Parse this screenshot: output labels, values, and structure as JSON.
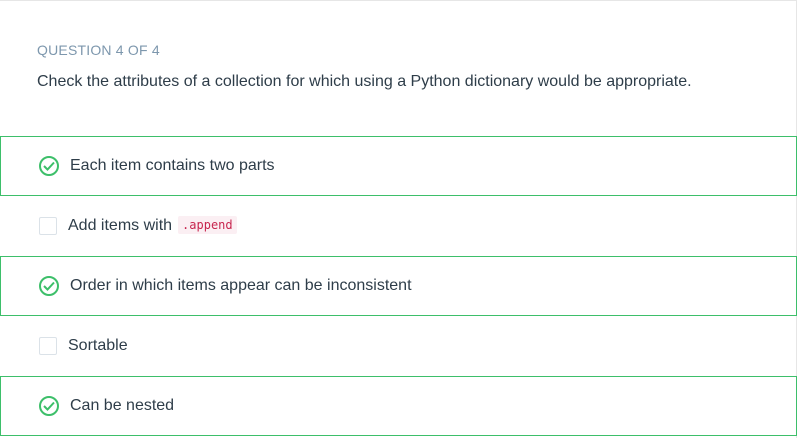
{
  "question": {
    "header": "QUESTION 4 OF 4",
    "text": "Check the attributes of a collection for which using a Python dictionary would be appropriate."
  },
  "options": [
    {
      "label": "Each item contains two parts",
      "checked": true,
      "code": ""
    },
    {
      "label": "Add items with",
      "checked": false,
      "code": ".append"
    },
    {
      "label": "Order in which items appear can be inconsistent",
      "checked": true,
      "code": ""
    },
    {
      "label": "Sortable",
      "checked": false,
      "code": ""
    },
    {
      "label": "Can be nested",
      "checked": true,
      "code": ""
    }
  ],
  "colors": {
    "accent_green": "#3dbf6a",
    "header_gray": "#7d97ad",
    "text": "#2e3d49",
    "code_text": "#c7254e"
  }
}
